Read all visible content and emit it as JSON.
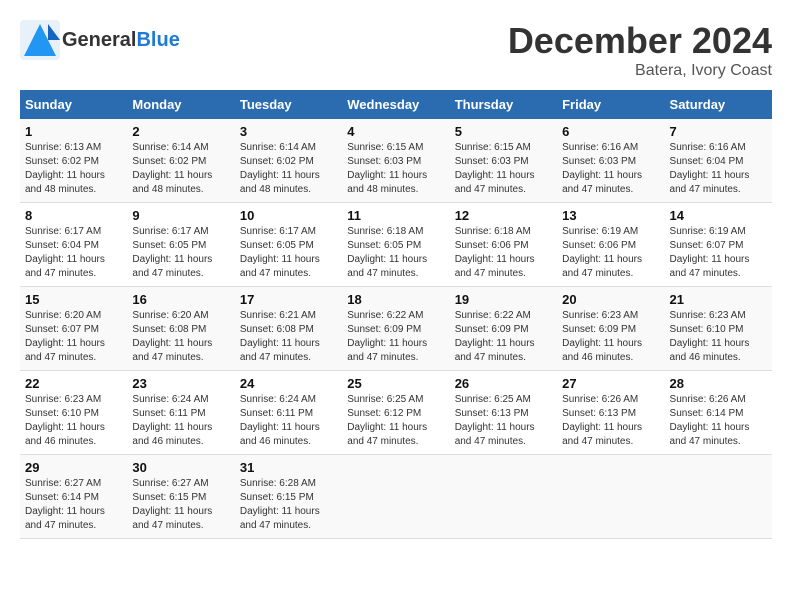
{
  "header": {
    "logo_general": "General",
    "logo_blue": "Blue",
    "title": "December 2024",
    "subtitle": "Batera, Ivory Coast"
  },
  "calendar": {
    "weekdays": [
      "Sunday",
      "Monday",
      "Tuesday",
      "Wednesday",
      "Thursday",
      "Friday",
      "Saturday"
    ],
    "weeks": [
      [
        {
          "day": "1",
          "info": "Sunrise: 6:13 AM\nSunset: 6:02 PM\nDaylight: 11 hours\nand 48 minutes."
        },
        {
          "day": "2",
          "info": "Sunrise: 6:14 AM\nSunset: 6:02 PM\nDaylight: 11 hours\nand 48 minutes."
        },
        {
          "day": "3",
          "info": "Sunrise: 6:14 AM\nSunset: 6:02 PM\nDaylight: 11 hours\nand 48 minutes."
        },
        {
          "day": "4",
          "info": "Sunrise: 6:15 AM\nSunset: 6:03 PM\nDaylight: 11 hours\nand 48 minutes."
        },
        {
          "day": "5",
          "info": "Sunrise: 6:15 AM\nSunset: 6:03 PM\nDaylight: 11 hours\nand 47 minutes."
        },
        {
          "day": "6",
          "info": "Sunrise: 6:16 AM\nSunset: 6:03 PM\nDaylight: 11 hours\nand 47 minutes."
        },
        {
          "day": "7",
          "info": "Sunrise: 6:16 AM\nSunset: 6:04 PM\nDaylight: 11 hours\nand 47 minutes."
        }
      ],
      [
        {
          "day": "8",
          "info": "Sunrise: 6:17 AM\nSunset: 6:04 PM\nDaylight: 11 hours\nand 47 minutes."
        },
        {
          "day": "9",
          "info": "Sunrise: 6:17 AM\nSunset: 6:05 PM\nDaylight: 11 hours\nand 47 minutes."
        },
        {
          "day": "10",
          "info": "Sunrise: 6:17 AM\nSunset: 6:05 PM\nDaylight: 11 hours\nand 47 minutes."
        },
        {
          "day": "11",
          "info": "Sunrise: 6:18 AM\nSunset: 6:05 PM\nDaylight: 11 hours\nand 47 minutes."
        },
        {
          "day": "12",
          "info": "Sunrise: 6:18 AM\nSunset: 6:06 PM\nDaylight: 11 hours\nand 47 minutes."
        },
        {
          "day": "13",
          "info": "Sunrise: 6:19 AM\nSunset: 6:06 PM\nDaylight: 11 hours\nand 47 minutes."
        },
        {
          "day": "14",
          "info": "Sunrise: 6:19 AM\nSunset: 6:07 PM\nDaylight: 11 hours\nand 47 minutes."
        }
      ],
      [
        {
          "day": "15",
          "info": "Sunrise: 6:20 AM\nSunset: 6:07 PM\nDaylight: 11 hours\nand 47 minutes."
        },
        {
          "day": "16",
          "info": "Sunrise: 6:20 AM\nSunset: 6:08 PM\nDaylight: 11 hours\nand 47 minutes."
        },
        {
          "day": "17",
          "info": "Sunrise: 6:21 AM\nSunset: 6:08 PM\nDaylight: 11 hours\nand 47 minutes."
        },
        {
          "day": "18",
          "info": "Sunrise: 6:22 AM\nSunset: 6:09 PM\nDaylight: 11 hours\nand 47 minutes."
        },
        {
          "day": "19",
          "info": "Sunrise: 6:22 AM\nSunset: 6:09 PM\nDaylight: 11 hours\nand 47 minutes."
        },
        {
          "day": "20",
          "info": "Sunrise: 6:23 AM\nSunset: 6:09 PM\nDaylight: 11 hours\nand 46 minutes."
        },
        {
          "day": "21",
          "info": "Sunrise: 6:23 AM\nSunset: 6:10 PM\nDaylight: 11 hours\nand 46 minutes."
        }
      ],
      [
        {
          "day": "22",
          "info": "Sunrise: 6:23 AM\nSunset: 6:10 PM\nDaylight: 11 hours\nand 46 minutes."
        },
        {
          "day": "23",
          "info": "Sunrise: 6:24 AM\nSunset: 6:11 PM\nDaylight: 11 hours\nand 46 minutes."
        },
        {
          "day": "24",
          "info": "Sunrise: 6:24 AM\nSunset: 6:11 PM\nDaylight: 11 hours\nand 46 minutes."
        },
        {
          "day": "25",
          "info": "Sunrise: 6:25 AM\nSunset: 6:12 PM\nDaylight: 11 hours\nand 47 minutes."
        },
        {
          "day": "26",
          "info": "Sunrise: 6:25 AM\nSunset: 6:13 PM\nDaylight: 11 hours\nand 47 minutes."
        },
        {
          "day": "27",
          "info": "Sunrise: 6:26 AM\nSunset: 6:13 PM\nDaylight: 11 hours\nand 47 minutes."
        },
        {
          "day": "28",
          "info": "Sunrise: 6:26 AM\nSunset: 6:14 PM\nDaylight: 11 hours\nand 47 minutes."
        }
      ],
      [
        {
          "day": "29",
          "info": "Sunrise: 6:27 AM\nSunset: 6:14 PM\nDaylight: 11 hours\nand 47 minutes."
        },
        {
          "day": "30",
          "info": "Sunrise: 6:27 AM\nSunset: 6:15 PM\nDaylight: 11 hours\nand 47 minutes."
        },
        {
          "day": "31",
          "info": "Sunrise: 6:28 AM\nSunset: 6:15 PM\nDaylight: 11 hours\nand 47 minutes."
        },
        {
          "day": "",
          "info": ""
        },
        {
          "day": "",
          "info": ""
        },
        {
          "day": "",
          "info": ""
        },
        {
          "day": "",
          "info": ""
        }
      ]
    ]
  }
}
